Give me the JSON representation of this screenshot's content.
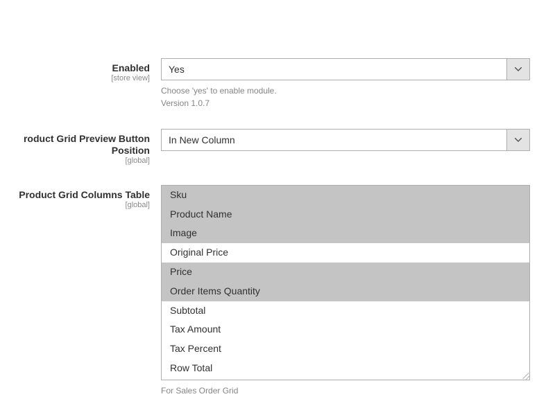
{
  "fields": {
    "enabled": {
      "label": "Enabled",
      "scope": "[store view]",
      "value": "Yes",
      "hint_line1": "Choose 'yes' to enable module.",
      "hint_line2": "Version 1.0.7"
    },
    "button_position": {
      "label": "roduct Grid Preview Button Position",
      "scope": "[global]",
      "value": "In New Column"
    },
    "columns_table": {
      "label": "Product Grid Columns Table",
      "scope": "[global]",
      "hint": "For Sales Order Grid",
      "options": [
        {
          "text": "Sku",
          "selected": true
        },
        {
          "text": "Product Name",
          "selected": true
        },
        {
          "text": "Image",
          "selected": true
        },
        {
          "text": "Original Price",
          "selected": false
        },
        {
          "text": "Price",
          "selected": true
        },
        {
          "text": "Order Items Quantity",
          "selected": true
        },
        {
          "text": "Subtotal",
          "selected": false
        },
        {
          "text": "Tax Amount",
          "selected": false
        },
        {
          "text": "Tax Percent",
          "selected": false
        },
        {
          "text": "Row Total",
          "selected": false
        }
      ]
    }
  }
}
